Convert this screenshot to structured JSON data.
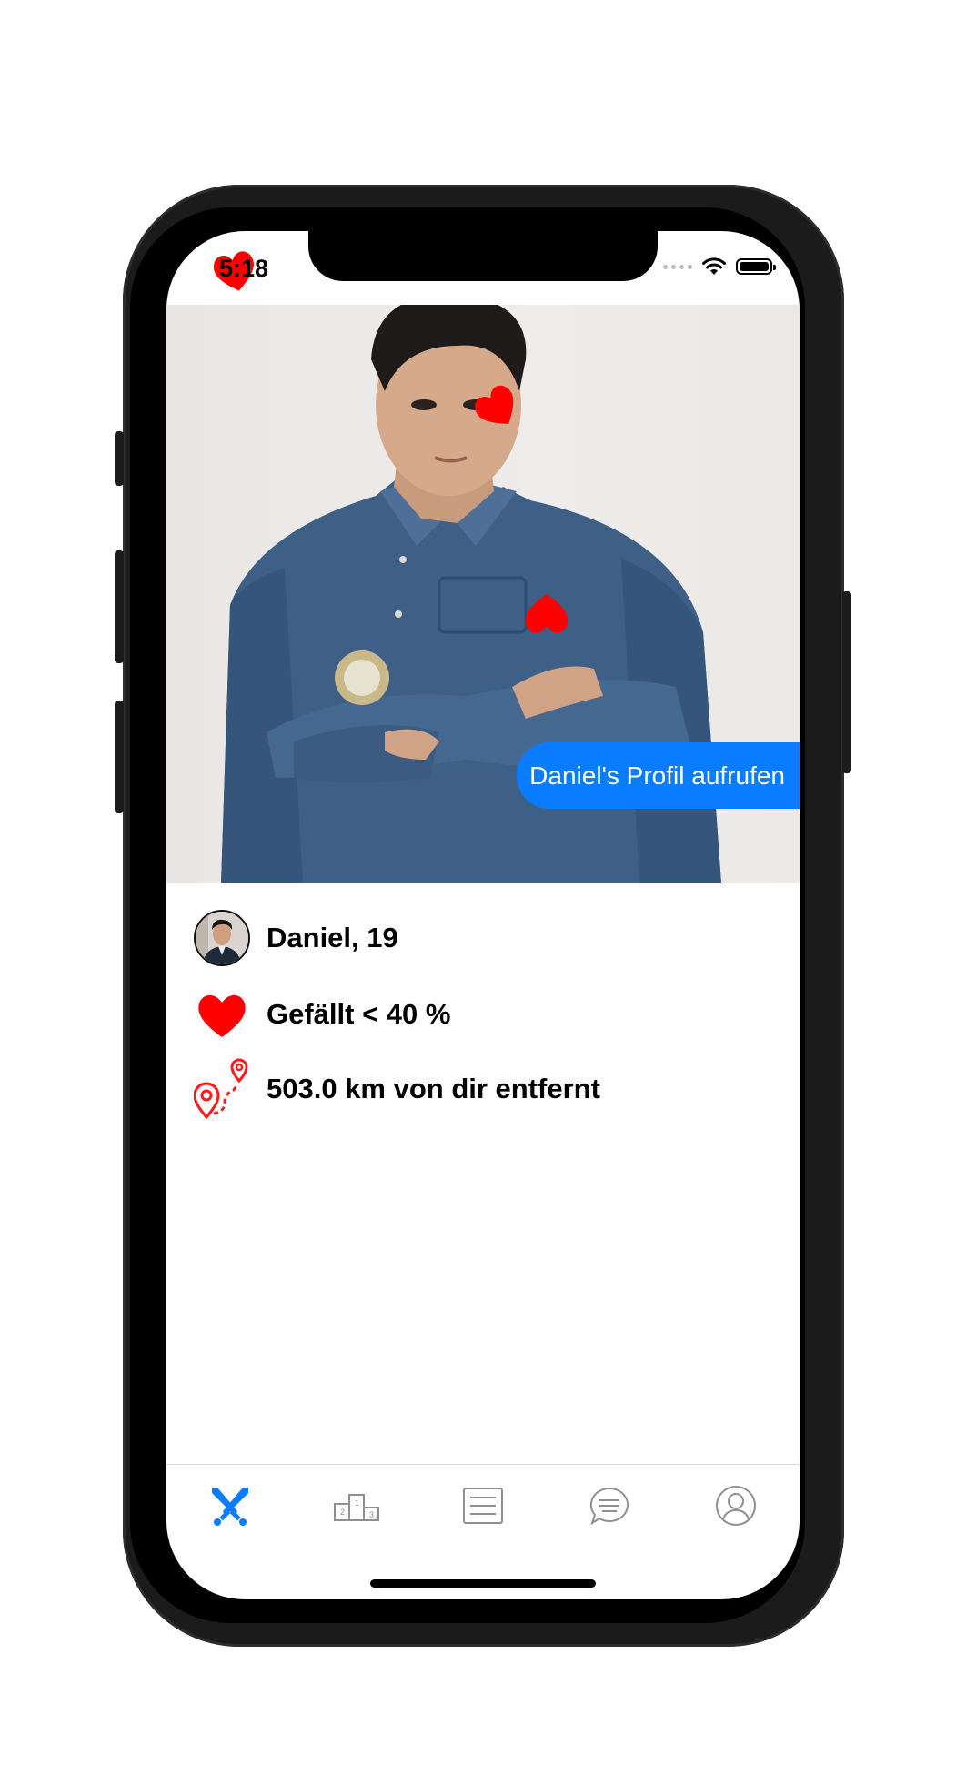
{
  "status_bar": {
    "time": "5:18"
  },
  "profile": {
    "view_profile_label": "Daniel's Profil aufrufen",
    "name_age": "Daniel, 19",
    "likes": "Gefällt < 40 %",
    "distance": "503.0 km von dir entfernt"
  },
  "tabbar": {
    "tabs": [
      {
        "icon": "crossed-swords-icon",
        "active": true
      },
      {
        "icon": "podium-icon",
        "active": false
      },
      {
        "icon": "list-icon",
        "active": false
      },
      {
        "icon": "chat-icon",
        "active": false
      },
      {
        "icon": "profile-icon",
        "active": false
      }
    ]
  },
  "colors": {
    "accent": "#0a7cff",
    "heart": "#ff0000",
    "inactive_icon": "#8e8e93"
  }
}
